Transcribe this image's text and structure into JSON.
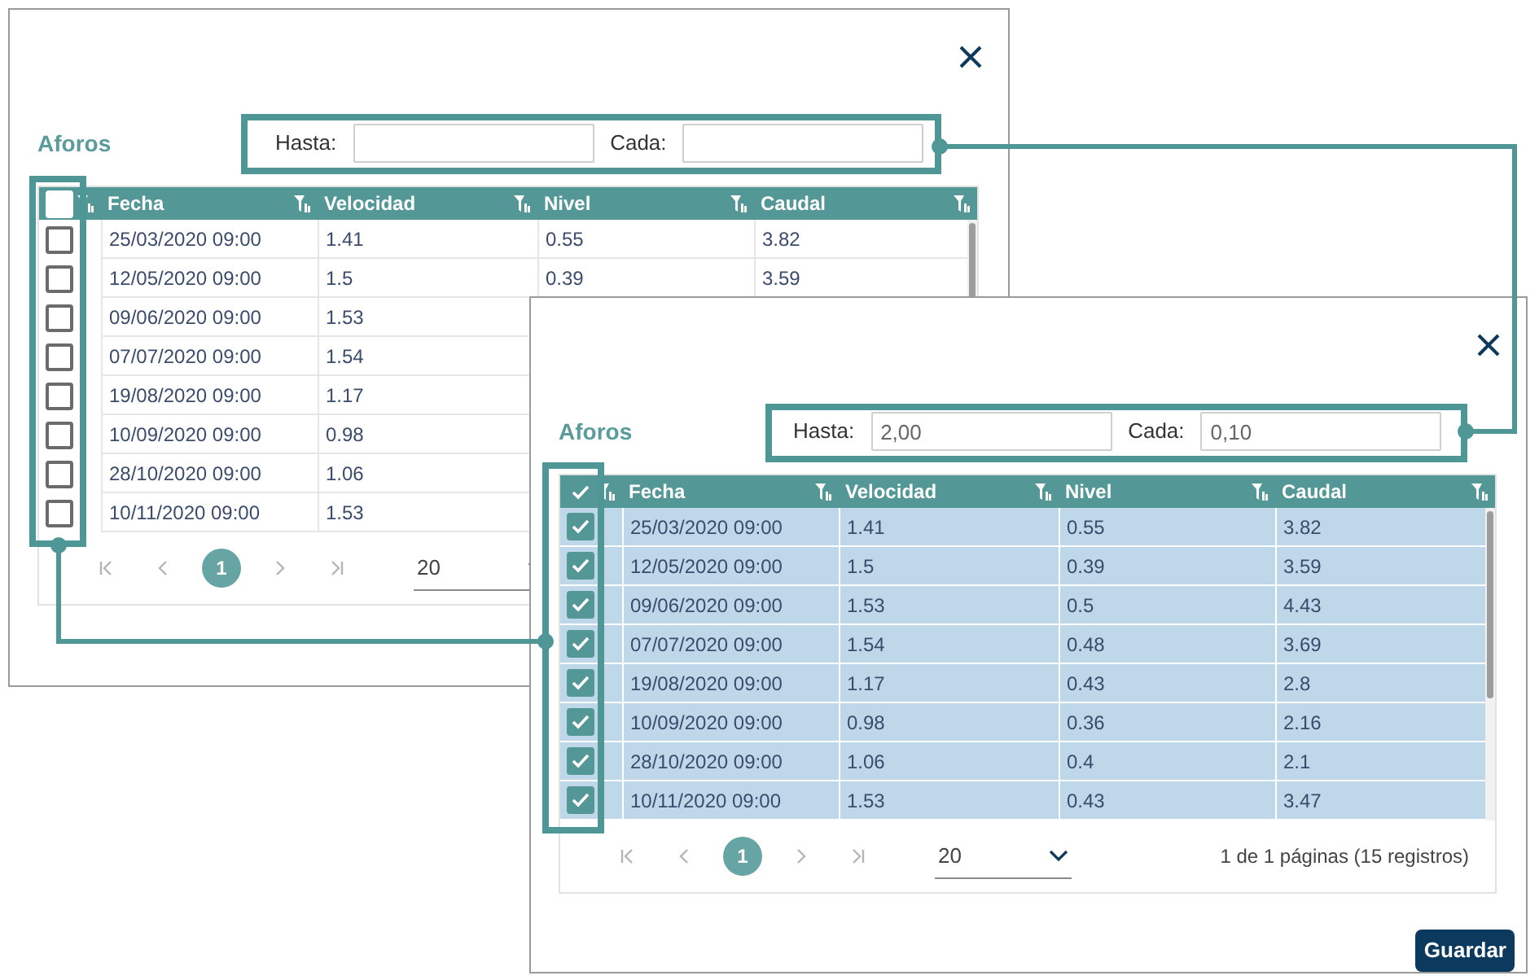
{
  "dialogs": [
    {
      "title": "Aforos",
      "filters": [
        {
          "label": "Hasta:"
        },
        {
          "label": "Cada:"
        }
      ],
      "columns": [
        "Fecha",
        "Velocidad",
        "Nivel",
        "Caudal"
      ],
      "select_all_checked": false,
      "rows": [
        {
          "checked": false,
          "cells": [
            "25/03/2020 09:00",
            "1.41",
            "0.55",
            "3.82"
          ]
        },
        {
          "checked": false,
          "cells": [
            "12/05/2020 09:00",
            "1.5",
            "0.39",
            "3.59"
          ]
        },
        {
          "checked": false,
          "cells": [
            "09/06/2020 09:00",
            "1.53"
          ]
        },
        {
          "checked": false,
          "cells": [
            "07/07/2020 09:00",
            "1.54"
          ]
        },
        {
          "checked": false,
          "cells": [
            "19/08/2020 09:00",
            "1.17"
          ]
        },
        {
          "checked": false,
          "cells": [
            "10/09/2020 09:00",
            "0.98"
          ]
        },
        {
          "checked": false,
          "cells": [
            "28/10/2020 09:00",
            "1.06"
          ]
        },
        {
          "checked": false,
          "cells": [
            "10/11/2020 09:00",
            "1.53"
          ]
        }
      ],
      "pagination": {
        "pages": [
          {
            "label": "1",
            "selected": true
          }
        ],
        "page_size": "20"
      }
    },
    {
      "title": "Aforos",
      "filters": [
        {
          "label": "Hasta:",
          "value": "2,00"
        },
        {
          "label": "Cada:",
          "value": "0,10"
        }
      ],
      "columns": [
        "Fecha",
        "Velocidad",
        "Nivel",
        "Caudal"
      ],
      "select_all_checked": true,
      "rows": [
        {
          "checked": true,
          "cells": [
            "25/03/2020 09:00",
            "1.41",
            "0.55",
            "3.82"
          ]
        },
        {
          "checked": true,
          "cells": [
            "12/05/2020 09:00",
            "1.5",
            "0.39",
            "3.59"
          ]
        },
        {
          "checked": true,
          "cells": [
            "09/06/2020 09:00",
            "1.53",
            "0.5",
            "4.43"
          ]
        },
        {
          "checked": true,
          "cells": [
            "07/07/2020 09:00",
            "1.54",
            "0.48",
            "3.69"
          ]
        },
        {
          "checked": true,
          "cells": [
            "19/08/2020 09:00",
            "1.17",
            "0.43",
            "2.8"
          ]
        },
        {
          "checked": true,
          "cells": [
            "10/09/2020 09:00",
            "0.98",
            "0.36",
            "2.16"
          ]
        },
        {
          "checked": true,
          "cells": [
            "28/10/2020 09:00",
            "1.06",
            "0.4",
            "2.1"
          ]
        },
        {
          "checked": true,
          "cells": [
            "10/11/2020 09:00",
            "1.53",
            "0.43",
            "3.47"
          ]
        }
      ],
      "pagination": {
        "pages": [
          {
            "label": "1",
            "selected": true
          }
        ],
        "page_size": "20",
        "summary": "1 de 1 páginas (15 registros)"
      },
      "button": "Guardar"
    }
  ]
}
